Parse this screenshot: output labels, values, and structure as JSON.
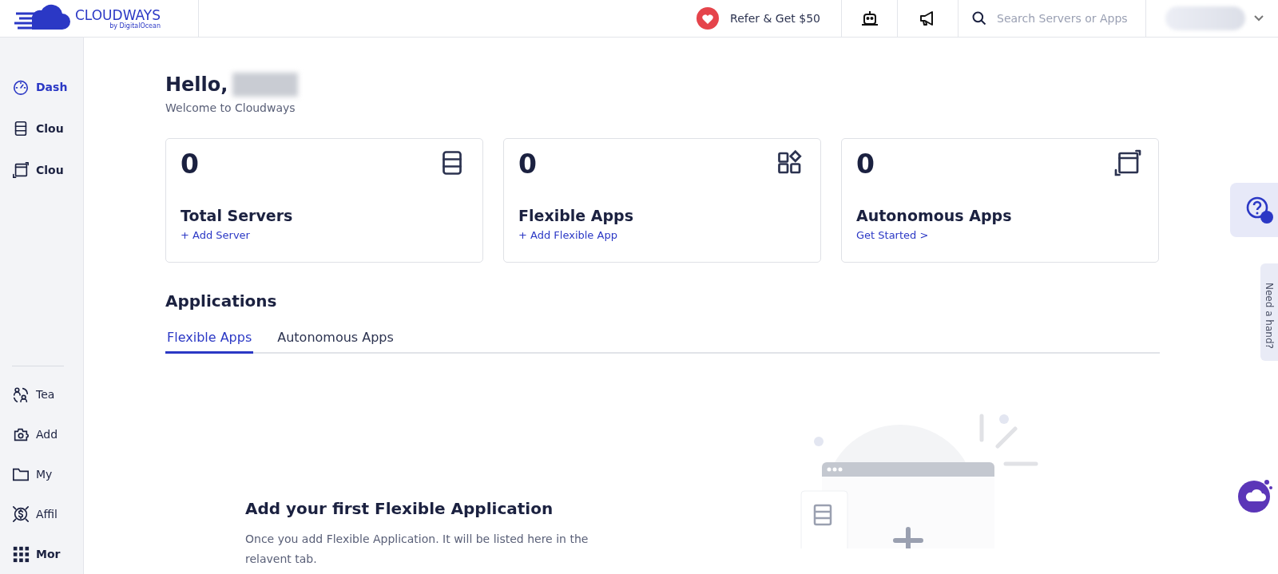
{
  "header": {
    "logo": {
      "name": "CLOUDWAYS",
      "byline": "by DigitalOcean"
    },
    "refer": "Refer & Get $50",
    "search": {
      "placeholder": "Search Servers or Apps"
    }
  },
  "sidebar": {
    "items": [
      {
        "label": "Dash",
        "kind": "gauge",
        "selected": true,
        "bold": true
      },
      {
        "label": "Clou",
        "kind": "servers",
        "selected": false,
        "bold": true
      },
      {
        "label": "Clou",
        "kind": "window",
        "selected": false,
        "bold": true
      }
    ],
    "bottom_items": [
      {
        "label": "Tea",
        "kind": "team",
        "bold": false
      },
      {
        "label": "Add",
        "kind": "addon",
        "bold": false
      },
      {
        "label": "My",
        "kind": "folder",
        "bold": false
      },
      {
        "label": "Affil",
        "kind": "dollar",
        "bold": false
      },
      {
        "label": "Mor",
        "kind": "grid",
        "bold": true
      }
    ]
  },
  "greeting": {
    "title": "Hello,",
    "subtitle": "Welcome to Cloudways"
  },
  "cards": [
    {
      "count": "0",
      "title": "Total Servers",
      "link": "+ Add Server",
      "kind": "servers"
    },
    {
      "count": "0",
      "title": "Flexible Apps",
      "link": "+ Add Flexible App",
      "kind": "apps"
    },
    {
      "count": "0",
      "title": "Autonomous Apps",
      "link": "Get Started >",
      "kind": "window"
    }
  ],
  "applications": {
    "heading": "Applications",
    "tabs": [
      {
        "label": "Flexible Apps",
        "selected": true
      },
      {
        "label": "Autonomous Apps",
        "selected": false
      }
    ],
    "empty_state": {
      "title": "Add your first Flexible Application",
      "text": "Once you add Flexible Application. It will be listed here in the relavent tab."
    }
  },
  "side_tab": "Need a hand?"
}
